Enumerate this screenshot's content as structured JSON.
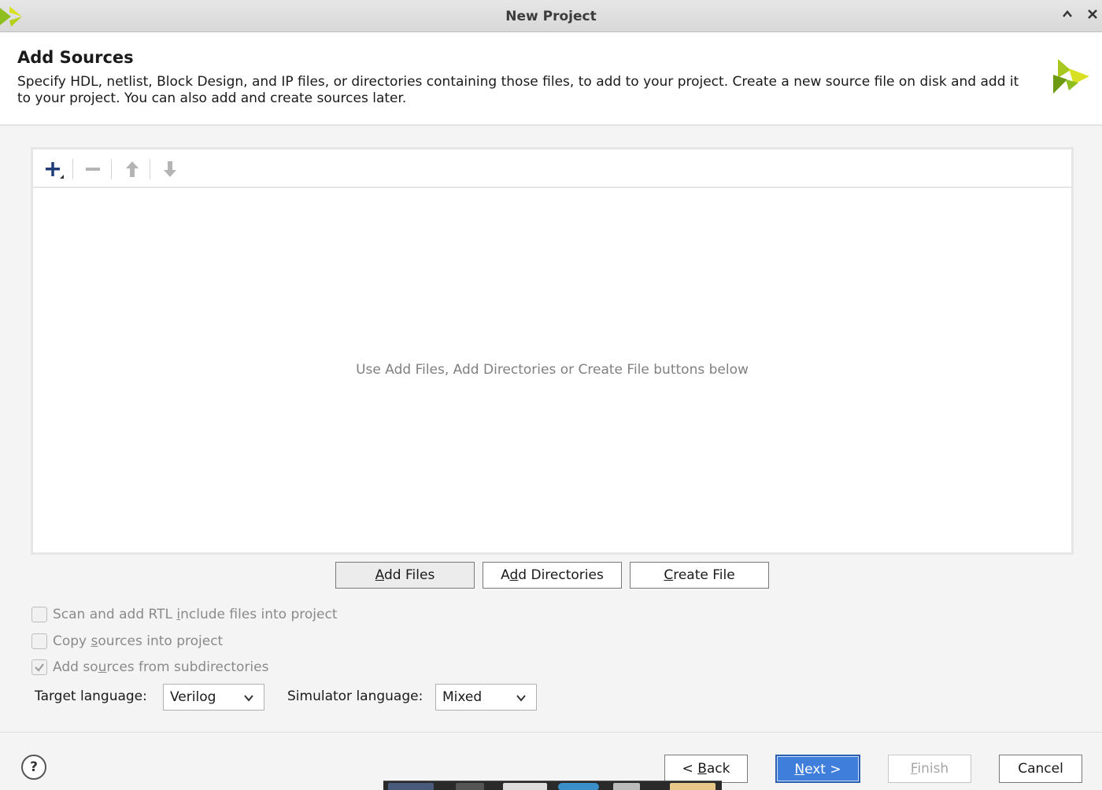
{
  "window": {
    "title": "New Project"
  },
  "header": {
    "heading": "Add Sources",
    "description": "Specify HDL, netlist, Block Design, and IP files, or directories containing those files, to add to your project. Create a new source file on disk and add it to your project. You can also add and create sources later."
  },
  "file_panel": {
    "toolbar": {
      "add_icon": "plus-icon",
      "remove_icon": "minus-icon",
      "up_icon": "arrow-up-icon",
      "down_icon": "arrow-down-icon"
    },
    "empty_message": "Use Add Files, Add Directories or Create File buttons below"
  },
  "actions": {
    "add_files": {
      "pre": "",
      "accel": "A",
      "post": "dd Files"
    },
    "add_directories": {
      "pre": "A",
      "accel": "d",
      "post": "d Directories"
    },
    "create_file": {
      "pre": "",
      "accel": "C",
      "post": "reate File"
    }
  },
  "options": {
    "scan_rtl": {
      "pre": "Scan and add RTL ",
      "accel": "i",
      "post": "nclude files into project",
      "checked": false
    },
    "copy_sources": {
      "pre": "Copy ",
      "accel": "s",
      "post": "ources into project",
      "checked": false
    },
    "add_subdirs": {
      "pre": "Add so",
      "accel": "u",
      "post": "rces from subdirectories",
      "checked": true
    }
  },
  "languages": {
    "target_label": "Target language:",
    "target_value": "Verilog",
    "simulator_label": "Simulator language:",
    "simulator_value": "Mixed"
  },
  "footer": {
    "help": "?",
    "back": {
      "pre": "< ",
      "accel": "B",
      "post": "ack"
    },
    "next": {
      "pre": "",
      "accel": "N",
      "post": "ext >"
    },
    "finish": {
      "pre": "",
      "accel": "F",
      "post": "inish"
    },
    "cancel": "Cancel"
  },
  "colors": {
    "primary_button": "#3f7fdb",
    "logo_green": "#8fbf1f",
    "logo_yellow": "#d9e021"
  }
}
